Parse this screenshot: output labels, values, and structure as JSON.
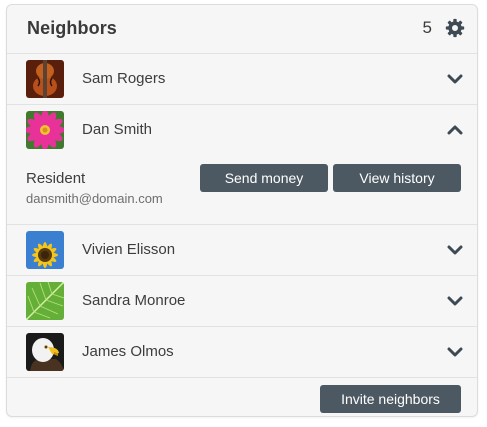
{
  "panel": {
    "title": "Neighbors",
    "count": "5",
    "settings_icon": "gear-icon"
  },
  "neighbors": [
    {
      "name": "Sam Rogers",
      "avatar": "violin",
      "expanded": false,
      "chevron": "chevron-down-icon"
    },
    {
      "name": "Dan Smith",
      "avatar": "pink-flower",
      "expanded": true,
      "chevron": "chevron-up-icon",
      "detail": {
        "role": "Resident",
        "email": "dansmith@domain.com",
        "send_label": "Send money",
        "history_label": "View history"
      }
    },
    {
      "name": "Vivien Elisson",
      "avatar": "sunflower",
      "expanded": false,
      "chevron": "chevron-down-icon"
    },
    {
      "name": "Sandra Monroe",
      "avatar": "green-leaf",
      "expanded": false,
      "chevron": "chevron-down-icon"
    },
    {
      "name": "James Olmos",
      "avatar": "eagle",
      "expanded": false,
      "chevron": "chevron-down-icon"
    }
  ],
  "footer": {
    "invite_label": "Invite neighbors"
  },
  "colors": {
    "button": "#4d5962",
    "panel_bg": "#f6f6f6",
    "divider": "#e2e2e2",
    "icon": "#3d4a54"
  }
}
